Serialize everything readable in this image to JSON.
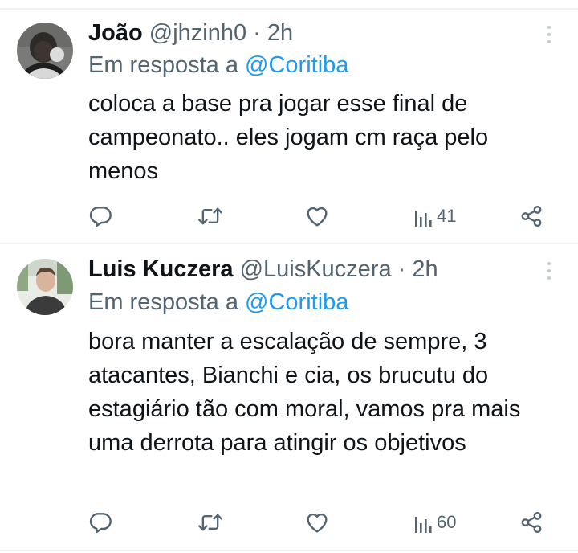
{
  "tweets": [
    {
      "name": "João",
      "handle": "@jhzinh0",
      "time": "· 2h",
      "reply_prefix": "Em resposta a",
      "reply_mention": "@Coritiba",
      "text": "coloca a base pra jogar esse final de campeonato.. eles jogam cm raça pelo menos",
      "views": "41",
      "icons": [
        "more-icon",
        "reply-icon",
        "retweet-icon",
        "like-icon",
        "views-icon",
        "share-icon"
      ]
    },
    {
      "name": "Luis Kuczera",
      "handle": "@LuisKuczera",
      "time": "· 2h",
      "reply_prefix": "Em resposta a",
      "reply_mention": "@Coritiba",
      "text": "bora manter a escalação de sempre, 3 atacantes, Bianchi e cia, os brucutu do estagiário tão com moral, vamos pra mais uma derrota para atingir os objetivos",
      "views": "60",
      "icons": [
        "more-icon",
        "reply-icon",
        "retweet-icon",
        "like-icon",
        "views-icon",
        "share-icon"
      ]
    }
  ],
  "colors": {
    "text": "#0f1419",
    "secondary": "#536471",
    "link": "#1d9bf0",
    "divider": "#eff3f4"
  }
}
